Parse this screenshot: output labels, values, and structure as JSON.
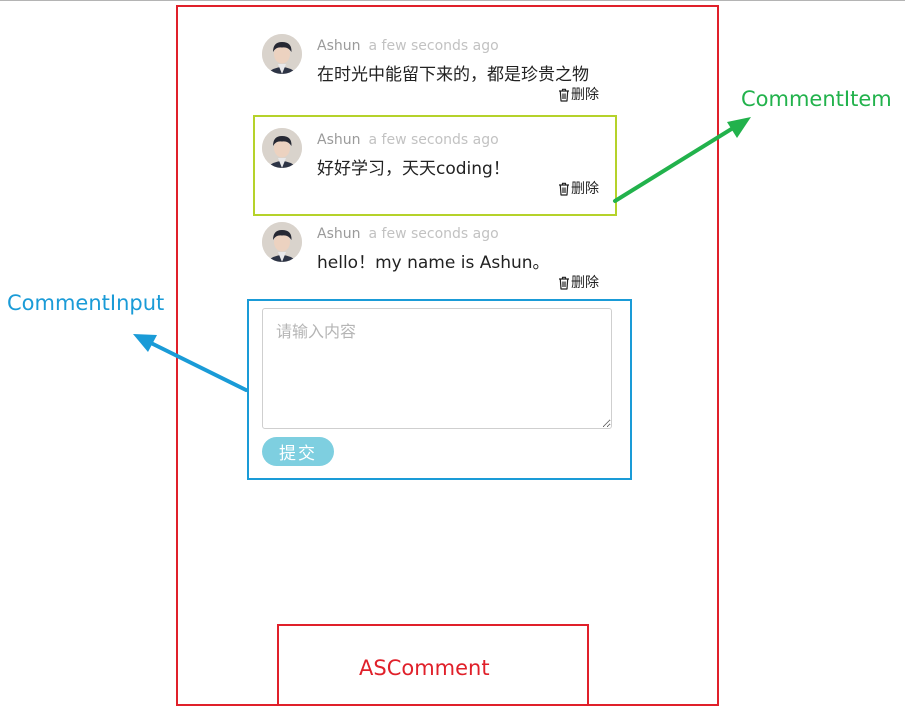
{
  "colors": {
    "outer_frame": "#e0202a",
    "item_frame": "#b5d22a",
    "input_frame": "#1a9bd7",
    "commentitem_label": "#22b24c",
    "commentinput_label": "#1a9bd7",
    "ascomment_label": "#e0202a",
    "submit_button": "#7ecfe0"
  },
  "labels": {
    "comment_item": "CommentItem",
    "comment_input": "CommentInput",
    "ascomment": "ASComment"
  },
  "comments": [
    {
      "author": "Ashun",
      "time": "a few seconds ago",
      "text": "在时光中能留下来的，都是珍贵之物",
      "delete_label": "删除",
      "avatar_icon": "user-avatar"
    },
    {
      "author": "Ashun",
      "time": "a few seconds ago",
      "text": "好好学习，天天coding！",
      "delete_label": "删除",
      "avatar_icon": "user-avatar"
    },
    {
      "author": "Ashun",
      "time": "a few seconds ago",
      "text": "hello！my name is Ashun。",
      "delete_label": "删除",
      "avatar_icon": "user-avatar"
    }
  ],
  "input": {
    "value": "",
    "placeholder": "请输入内容",
    "submit_label": "提交"
  }
}
